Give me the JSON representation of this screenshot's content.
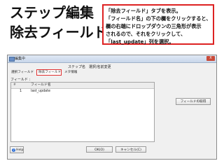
{
  "slide": {
    "title_line1": "ステップ編集",
    "title_line2": "除去フィールド"
  },
  "callout": {
    "lines": [
      "「除去フィールド」タブを表示。",
      "「フィールド名」の下の欄をクリックすると、",
      "欄の右端にドロップダウンの三角形が表示",
      "されるので、それをクリックして、",
      "「last_update」列を選択。"
    ]
  },
  "dialog": {
    "title": "編集中",
    "close_glyph": "X",
    "step_name_label": "ステップ名",
    "step_name_value": "選択/名前変更",
    "tabs": [
      "選択フィールド",
      "除去フィールド",
      "メタ情報"
    ],
    "section_label": "フィールド :",
    "grid": {
      "header_marker": "#",
      "column_header": "フィールド名",
      "rows": [
        {
          "num": "1",
          "value": "last_update"
        }
      ]
    },
    "get_fields_button": "フィールドの取得",
    "ok_button": "OK(O)",
    "cancel_button": "キャンセル(C)",
    "help_button": "Help"
  }
}
